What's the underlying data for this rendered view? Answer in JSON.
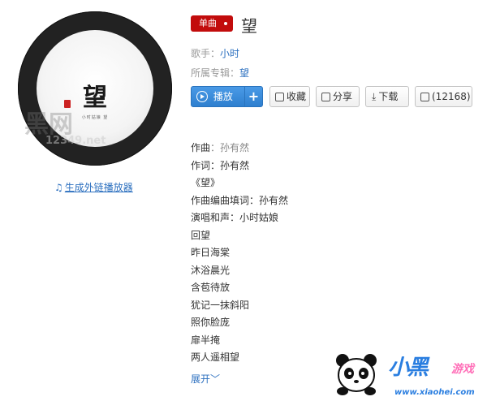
{
  "album": {
    "art_title": "望",
    "art_caption": "小时姑娘 望",
    "watermark_big": "黑网",
    "watermark_small": "12349.net"
  },
  "outlink": {
    "label": "生成外链播放器"
  },
  "song": {
    "badge": "单曲",
    "title": "望",
    "singer_label": "歌手：",
    "singer": "小时",
    "album_label": "所属专辑：",
    "album": "望"
  },
  "buttons": {
    "play": "播放",
    "add": "+",
    "favorite": "收藏",
    "share": "分享",
    "download": "下载",
    "comments": "(12168)"
  },
  "lyrics": [
    {
      "label": "作曲",
      "sep": "：",
      "value": "孙有然"
    },
    {
      "label": "作词",
      "sep": "：",
      "value": "孙有然"
    },
    {
      "label": "《望》",
      "sep": "",
      "value": ""
    },
    {
      "label": "作曲编曲填词",
      "sep": "：",
      "value": "孙有然"
    },
    {
      "label": "演唱和声",
      "sep": "：",
      "value": "小时姑娘"
    },
    {
      "label": "回望",
      "sep": "",
      "value": ""
    },
    {
      "label": "昨日海棠",
      "sep": "",
      "value": ""
    },
    {
      "label": "沐浴晨光",
      "sep": "",
      "value": ""
    },
    {
      "label": "含苞待放",
      "sep": "",
      "value": ""
    },
    {
      "label": "犹记一抹斜阳",
      "sep": "",
      "value": ""
    },
    {
      "label": "照你脸庞",
      "sep": "",
      "value": ""
    },
    {
      "label": "扉半掩",
      "sep": "",
      "value": ""
    },
    {
      "label": "两人遥相望",
      "sep": "",
      "value": ""
    }
  ],
  "expand": {
    "label": "展开"
  },
  "logo": {
    "text": "小黑",
    "sub": "游戏",
    "url": "www.xiaohei.com"
  }
}
